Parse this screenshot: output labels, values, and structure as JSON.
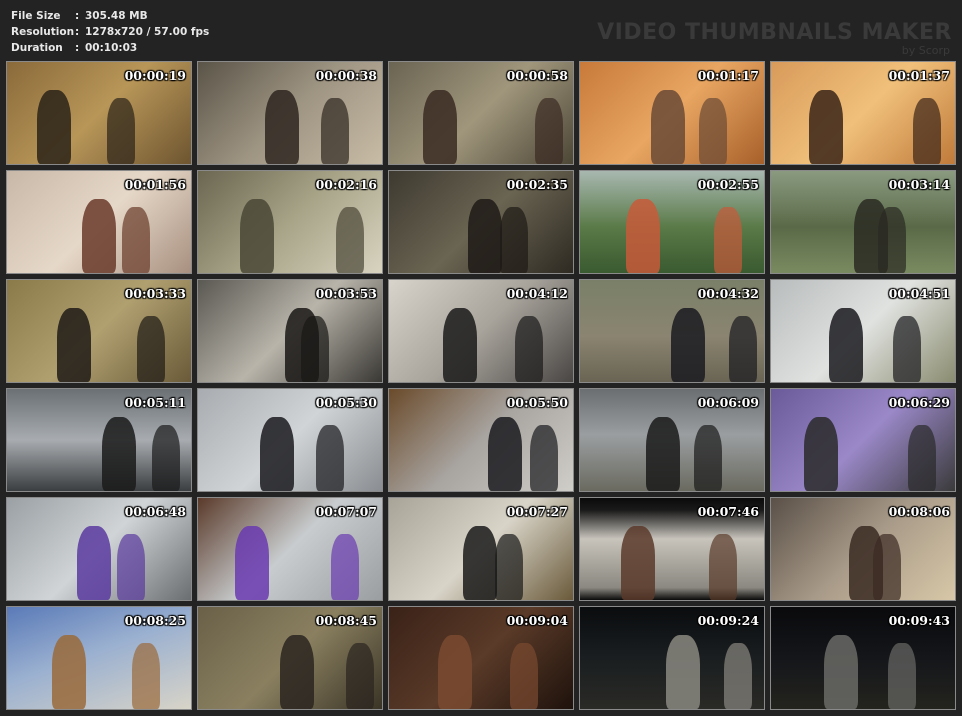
{
  "info": {
    "rows": [
      {
        "label": "File Size",
        "value": "305.48 MB"
      },
      {
        "label": "Resolution",
        "value": "1278x720 / 57.00 fps"
      },
      {
        "label": "Duration",
        "value": "00:10:03"
      }
    ]
  },
  "brand": {
    "title": "VIDEO THUMBNAILS MAKER",
    "subtitle": "by Scorp"
  },
  "thumbnails": [
    {
      "time": "00:00:19",
      "bg": "linear-gradient(135deg,#8a6a3a 0%,#b89658 50%,#6e5530 100%)",
      "fig": "#2a2218"
    },
    {
      "time": "00:00:38",
      "bg": "linear-gradient(135deg,#5a5448 0%,#9e9482 50%,#c8bca6 100%)",
      "fig": "#2e2620"
    },
    {
      "time": "00:00:58",
      "bg": "linear-gradient(135deg,#6a6452 0%,#a0967c 50%,#4c4636 100%)",
      "fig": "#3a2a22"
    },
    {
      "time": "00:01:17",
      "bg": "linear-gradient(135deg,#c87a3a 0%,#e8a662 50%,#a8602a 100%)",
      "fig": "#6a4a36"
    },
    {
      "time": "00:01:37",
      "bg": "linear-gradient(135deg,#d89a5a 0%,#f0c07a 50%,#c07a3a 100%)",
      "fig": "#3a2418"
    },
    {
      "time": "00:01:56",
      "bg": "linear-gradient(135deg,#c8b8a8 0%,#e6d8c8 50%,#a89080 100%)",
      "fig": "#6a3a2a"
    },
    {
      "time": "00:02:16",
      "bg": "linear-gradient(135deg,#6a6650 0%,#a8a488 50%,#d8d4c0 100%)",
      "fig": "#4a4636"
    },
    {
      "time": "00:02:35",
      "bg": "linear-gradient(135deg,#3e3a30 0%,#6a6452 50%,#2e2a22 100%)",
      "fig": "#1e1a16"
    },
    {
      "time": "00:02:55",
      "bg": "linear-gradient(180deg,#a8b8b0 0%,#5a7a48 55%,#3a5a30 100%)",
      "fig": "#c85a3a"
    },
    {
      "time": "00:03:14",
      "bg": "linear-gradient(180deg,#8a9a80 0%,#5a6a48 55%,#7a8a60 100%)",
      "fig": "#2a2a22"
    },
    {
      "time": "00:03:33",
      "bg": "linear-gradient(135deg,#8a7a4a 0%,#b0a070 50%,#6a5a38 100%)",
      "fig": "#1e1a16"
    },
    {
      "time": "00:03:53",
      "bg": "linear-gradient(135deg,#5a5852 0%,#b8b4aa 50%,#3a3834 100%)",
      "fig": "#1a1816"
    },
    {
      "time": "00:04:12",
      "bg": "linear-gradient(135deg,#d8d4cc 0%,#a8a49c 50%,#4a4644 100%)",
      "fig": "#1a1a1a"
    },
    {
      "time": "00:04:32",
      "bg": "linear-gradient(180deg,#7a8068 0%,#8a8470 55%,#6a6454 100%)",
      "fig": "#1a1a20"
    },
    {
      "time": "00:04:51",
      "bg": "linear-gradient(135deg,#b8bcbc 0%,#e0e2e0 50%,#8a8c70 100%)",
      "fig": "#1a1a1e"
    },
    {
      "time": "00:05:11",
      "bg": "linear-gradient(180deg,#6a7074 0%,#a8acb0 50%,#3a3e40 100%)",
      "fig": "#1a1a1a"
    },
    {
      "time": "00:05:30",
      "bg": "linear-gradient(135deg,#a8acb0 0%,#d0d4d6 50%,#8a8e92 100%)",
      "fig": "#1a1a1e"
    },
    {
      "time": "00:05:50",
      "bg": "linear-gradient(135deg,#6a4a2a 0%,#a8a4a0 50%,#d0cec8 100%)",
      "fig": "#1a1a1e"
    },
    {
      "time": "00:06:09",
      "bg": "linear-gradient(180deg,#6a6e70 0%,#9a9ea0 45%,#6a6a60 100%)",
      "fig": "#1a1a1a"
    },
    {
      "time": "00:06:29",
      "bg": "linear-gradient(135deg,#6a5a9a 0%,#9a88c8 50%,#3a3a3a 100%)",
      "fig": "#2a2a2a"
    },
    {
      "time": "00:06:48",
      "bg": "linear-gradient(135deg,#9aa0a4 0%,#d0d4d6 50%,#6a6e70 100%)",
      "fig": "#5a3aa0"
    },
    {
      "time": "00:07:07",
      "bg": "linear-gradient(135deg,#5a3a2a 0%,#c8ccce 50%,#9a9ea0 100%)",
      "fig": "#6a3ab0"
    },
    {
      "time": "00:07:27",
      "bg": "linear-gradient(135deg,#a8a498 0%,#d8d4c8 50%,#6a5a3a 100%)",
      "fig": "#1a1a1a"
    },
    {
      "time": "00:07:46",
      "bg": "linear-gradient(180deg,#0a0a0a 0%,#1a1a1a 12%,#c8c4bc 40%,#8a8880 88%,#0a0a0a 100%)",
      "fig": "#5a3a2a"
    },
    {
      "time": "00:08:06",
      "bg": "linear-gradient(135deg,#5a5048 0%,#a89a88 50%,#d8c8a8 100%)",
      "fig": "#3a2a22"
    },
    {
      "time": "00:08:25",
      "bg": "linear-gradient(160deg,#5a7ab8 0%,#9ab0d0 45%,#d8d4c8 100%)",
      "fig": "#9a6a3a"
    },
    {
      "time": "00:08:45",
      "bg": "linear-gradient(135deg,#6a6048 0%,#8a8060 50%,#3a3426 100%)",
      "fig": "#2a2420"
    },
    {
      "time": "00:09:04",
      "bg": "linear-gradient(135deg,#3a2218 0%,#5a3a28 50%,#1e120c 100%)",
      "fig": "#7a4a30"
    },
    {
      "time": "00:09:24",
      "bg": "linear-gradient(180deg,#0a0c0e 0%,#1a1e20 50%,#2a2a26 100%)",
      "fig": "#8a8880"
    },
    {
      "time": "00:09:43",
      "bg": "linear-gradient(180deg,#0a0a0c 0%,#14161a 50%,#24241e 100%)",
      "fig": "#6a6a66"
    }
  ]
}
